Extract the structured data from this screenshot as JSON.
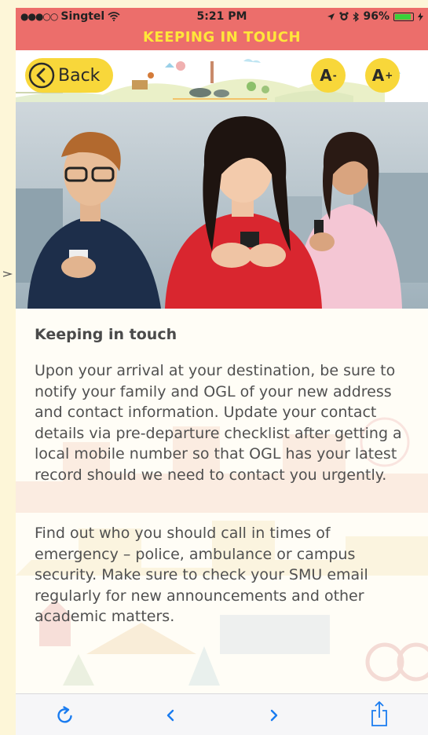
{
  "status_bar": {
    "carrier": "Singtel",
    "time": "5:21 PM",
    "battery": "96%",
    "battery_level": 0.96
  },
  "header": {
    "title": "KEEPING IN TOUCH",
    "back_label": "Back",
    "font_decrease_label": "A",
    "font_decrease_mark": "-",
    "font_increase_label": "A",
    "font_increase_mark": "+"
  },
  "article": {
    "heading": "Keeping in touch",
    "paragraphs": [
      "Upon your arrival at your destination, be sure to notify your family and OGL of your new address and contact information. Update your contact details via pre-departure checklist after getting a local mobile number so that OGL has your latest record should we need to contact you urgently.",
      "Find out who you should call in times of emergency – police, ambulance or campus security. Make sure to check your SMU email regularly for new announcements and other academic matters."
    ]
  },
  "toolbar": {
    "icons": [
      "reload-icon",
      "back-arrow-icon",
      "forward-arrow-icon",
      "share-icon"
    ]
  },
  "colors": {
    "title_bar": "#ec6e6b",
    "title_text": "#ffe63a",
    "button_yellow": "#f8d73a",
    "toolbar_blue": "#1a7cf0",
    "page_bg": "#fdf6d8"
  }
}
